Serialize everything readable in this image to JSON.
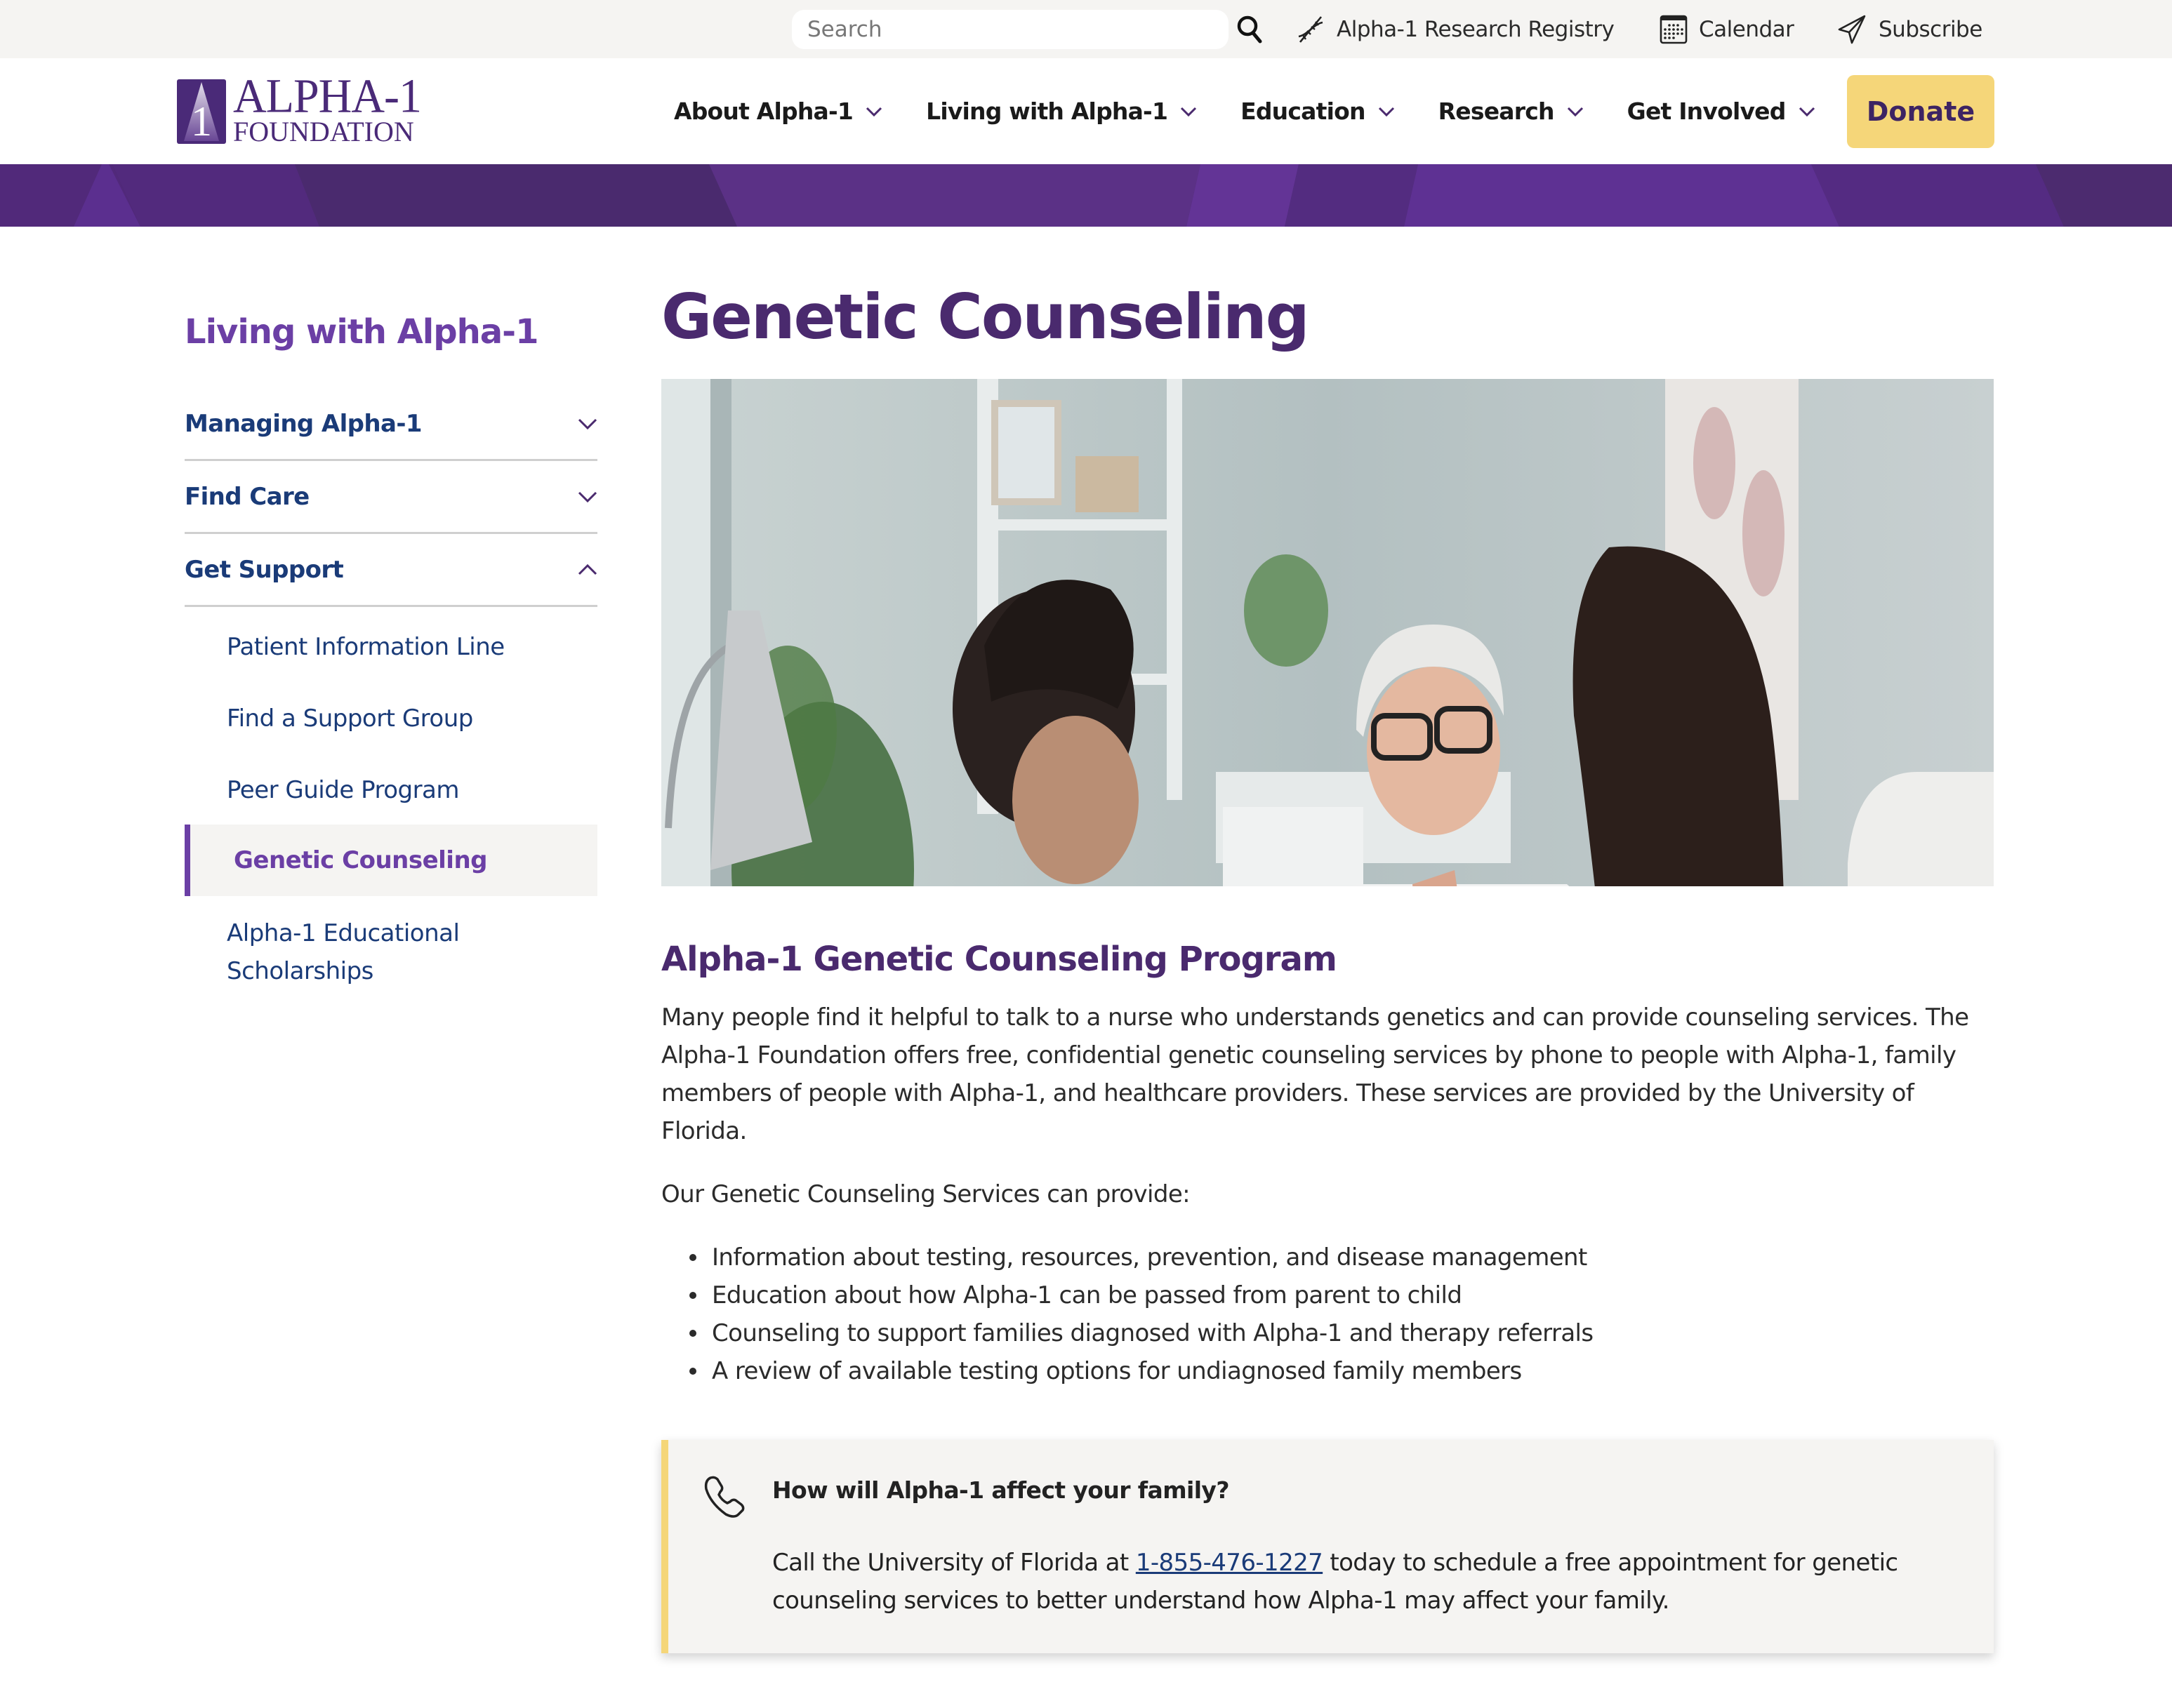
{
  "utility": {
    "search_placeholder": "Search",
    "search_value": "",
    "search_icon": "search-icon",
    "links": [
      {
        "label": "Alpha-1 Research Registry",
        "icon": "dna-icon"
      },
      {
        "label": "Calendar",
        "icon": "calendar-icon"
      },
      {
        "label": "Subscribe",
        "icon": "paper-plane-icon"
      }
    ]
  },
  "brand": {
    "name_top": "ALPHA-1",
    "name_bottom": "FOUNDATION",
    "mark_glyph": "1",
    "color_primary": "#4a2a6e",
    "color_accent": "#6b3fa5",
    "color_donate": "#f5d679",
    "color_link": "#1a3b78"
  },
  "nav": {
    "items": [
      {
        "label": "About Alpha-1",
        "icon": "chevron-down-icon"
      },
      {
        "label": "Living with Alpha-1",
        "icon": "chevron-down-icon"
      },
      {
        "label": "Education",
        "icon": "chevron-down-icon"
      },
      {
        "label": "Research",
        "icon": "chevron-down-icon"
      },
      {
        "label": "Get Involved",
        "icon": "chevron-down-icon"
      }
    ],
    "donate_label": "Donate"
  },
  "sidebar": {
    "title": "Living with Alpha-1",
    "sections": [
      {
        "label": "Managing Alpha-1",
        "expanded": false
      },
      {
        "label": "Find Care",
        "expanded": false
      },
      {
        "label": "Get Support",
        "expanded": true
      }
    ],
    "sub_items": [
      {
        "label": "Patient Information Line",
        "active": false
      },
      {
        "label": "Find a Support Group",
        "active": false
      },
      {
        "label": "Peer Guide Program",
        "active": false
      },
      {
        "label": "Genetic Counseling",
        "active": true
      },
      {
        "label": "Alpha-1 Educational Scholarships",
        "active": false
      }
    ]
  },
  "main": {
    "title": "Genetic Counseling",
    "hero_alt": "Genetic counselor meeting with a couple at a desk",
    "section_title": "Alpha-1 Genetic Counseling Program",
    "paragraph_1": "Many people find it helpful to talk to a nurse who understands genetics and can provide counseling services.  The Alpha-1 Foundation offers free, confidential genetic counseling services by phone to people with Alpha-1, family members of people with Alpha-1, and healthcare providers.  These services are provided by the University of Florida.",
    "paragraph_2": "Our Genetic Counseling Services can provide:",
    "bullets": [
      "Information about testing, resources, prevention, and disease management",
      "Education about how Alpha-1 can be passed from parent to child",
      "Counseling to support families diagnosed with Alpha-1 and therapy referrals",
      "A review of available testing options for undiagnosed family members"
    ],
    "callout": {
      "icon": "phone-icon",
      "title": "How will Alpha-1 affect your family?",
      "body_before": "Call the University of Florida at ",
      "phone": "1-855-476-1227",
      "body_after": " today to schedule a free appointment for genetic counseling services to better understand how Alpha-1 may affect your family."
    }
  }
}
